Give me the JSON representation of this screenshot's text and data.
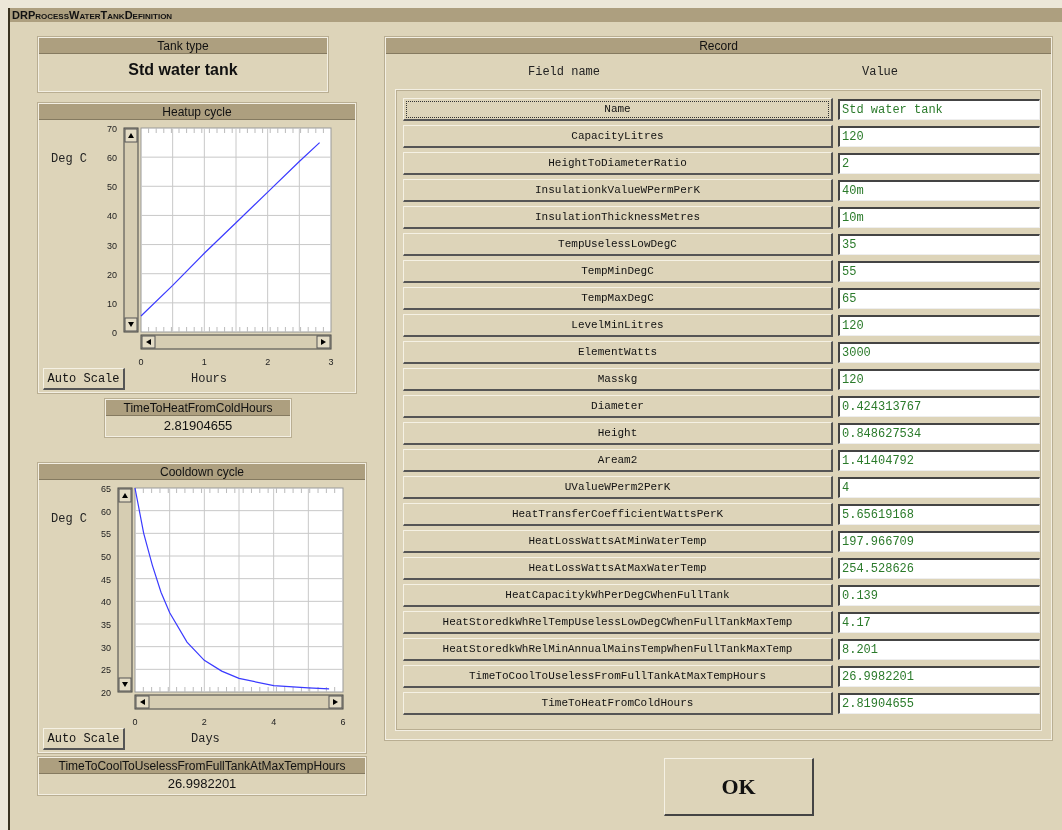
{
  "window": {
    "title": "DRProcessWaterTankDefinition"
  },
  "tank_type": {
    "label": "Tank type",
    "value": "Std water tank"
  },
  "charts": [
    {
      "title": "Heatup cycle",
      "button": "Auto Scale",
      "chart_data": {
        "type": "line",
        "xlabel": "Hours",
        "ylabel": "Deg C",
        "x": [
          0,
          0.5,
          1,
          1.5,
          2,
          2.5,
          2.82
        ],
        "series": [
          {
            "color": "#3a3aff",
            "values": [
              5.5,
              16,
              27,
              37.5,
              48,
              58.5,
              65
            ]
          }
        ],
        "xlim": [
          0,
          3
        ],
        "ylim": [
          0,
          70
        ],
        "xticks": [
          0,
          1,
          2,
          3
        ],
        "yticks": [
          0,
          10,
          20,
          30,
          40,
          50,
          60,
          70
        ],
        "grid": true
      },
      "result": {
        "label": "TimeToHeatFromColdHours",
        "value": "2.81904655"
      }
    },
    {
      "title": "Cooldown cycle",
      "button": "Auto Scale",
      "chart_data": {
        "type": "line",
        "xlabel": "Days",
        "ylabel": "Deg C",
        "x": [
          0,
          0.25,
          0.5,
          0.75,
          1,
          1.5,
          2,
          2.5,
          3,
          4,
          5,
          5.6
        ],
        "series": [
          {
            "color": "#3a3aff",
            "values": [
              65,
              55,
              48,
              42,
              37.5,
              31,
              27,
              24.6,
              23,
              21.4,
              20.9,
              20.7
            ]
          }
        ],
        "xlim": [
          0,
          6
        ],
        "ylim": [
          20,
          65
        ],
        "xticks": [
          0,
          2,
          4,
          6
        ],
        "yticks": [
          20,
          25,
          30,
          35,
          40,
          45,
          50,
          55,
          60,
          65
        ],
        "grid": true
      },
      "result": {
        "label": "TimeToCoolToUselessFromFullTankAtMaxTempHours",
        "value": "26.9982201"
      }
    }
  ],
  "record": {
    "title": "Record",
    "columns": [
      "Field name",
      "Value"
    ],
    "fields": [
      {
        "name": "Name",
        "value": "Std water tank",
        "focused": true
      },
      {
        "name": "CapacityLitres",
        "value": "120",
        "focused": false
      },
      {
        "name": "HeightToDiameterRatio",
        "value": "2",
        "focused": false
      },
      {
        "name": "InsulationkValueWPermPerK",
        "value": "40m",
        "focused": false
      },
      {
        "name": "InsulationThicknessMetres",
        "value": "10m",
        "focused": false
      },
      {
        "name": "TempUselessLowDegC",
        "value": "35",
        "focused": false
      },
      {
        "name": "TempMinDegC",
        "value": "55",
        "focused": false
      },
      {
        "name": "TempMaxDegC",
        "value": "65",
        "focused": false
      },
      {
        "name": "LevelMinLitres",
        "value": "120",
        "focused": false
      },
      {
        "name": "ElementWatts",
        "value": "3000",
        "focused": false
      },
      {
        "name": "Masskg",
        "value": "120",
        "focused": false
      },
      {
        "name": "Diameter",
        "value": "0.424313767",
        "focused": false
      },
      {
        "name": "Height",
        "value": "0.848627534",
        "focused": false
      },
      {
        "name": "Aream2",
        "value": "1.41404792",
        "focused": false
      },
      {
        "name": "UValueWPerm2PerK",
        "value": "4",
        "focused": false
      },
      {
        "name": "HeatTransferCoefficientWattsPerK",
        "value": "5.65619168",
        "focused": false
      },
      {
        "name": "HeatLossWattsAtMinWaterTemp",
        "value": "197.966709",
        "focused": false
      },
      {
        "name": "HeatLossWattsAtMaxWaterTemp",
        "value": "254.528626",
        "focused": false
      },
      {
        "name": "HeatCapacitykWhPerDegCWhenFullTank",
        "value": "0.139",
        "focused": false
      },
      {
        "name": "HeatStoredkWhRelTempUselessLowDegCWhenFullTankMaxTemp",
        "value": "4.17",
        "focused": false
      },
      {
        "name": "HeatStoredkWhRelMinAnnualMainsTempWhenFullTankMaxTemp",
        "value": "8.201",
        "focused": false
      },
      {
        "name": "TimeToCoolToUselessFromFullTankAtMaxTempHours",
        "value": "26.9982201",
        "focused": false
      },
      {
        "name": "TimeToHeatFromColdHours",
        "value": "2.81904655",
        "focused": false
      }
    ]
  },
  "ok_button": "OK"
}
